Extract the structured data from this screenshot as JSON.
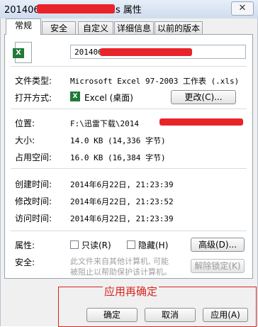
{
  "title": {
    "prefix": "201406",
    "suffix": "xls 属性",
    "close": "✕"
  },
  "tabs": [
    "常规",
    "安全",
    "自定义",
    "详细信息",
    "以前的版本"
  ],
  "general": {
    "filename": "201406",
    "file_type_label": "文件类型:",
    "file_type_value": "Microsoft Excel 97-2003 工作表 (.xls)",
    "open_with_label": "打开方式:",
    "open_with_value": "Excel (桌面)",
    "change_button": "更改(C)...",
    "location_label": "位置:",
    "location_value": "F:\\迅雷下载\\2014",
    "size_label": "大小:",
    "size_value": "14.0 KB (14,336 字节)",
    "size_on_disk_label": "占用空间:",
    "size_on_disk_value": "16.0 KB (16,384 字节)",
    "created_label": "创建时间:",
    "created_value": "2014年6月22日, 21:23:39",
    "modified_label": "修改时间:",
    "modified_value": "2014年6月22日, 21:23:52",
    "accessed_label": "访问时间:",
    "accessed_value": "2014年6月22日, 21:23:39",
    "attributes_label": "属性:",
    "readonly_label": "只读(R)",
    "hidden_label": "隐藏(H)",
    "advanced_button": "高级(D)...",
    "security_label": "安全:",
    "security_text_1": "此文件来自其他计算机, 可能",
    "security_text_2": "被阻止以帮助保护该计算机。",
    "unblock_button": "解除锁定(K)"
  },
  "footer": {
    "ok": "确定",
    "cancel": "取消",
    "apply": "应用(A)"
  },
  "annotation": {
    "text": "应用再确定",
    "color": "#d8261e"
  },
  "icons": {
    "excel": "excel-icon",
    "close": "close-icon"
  }
}
